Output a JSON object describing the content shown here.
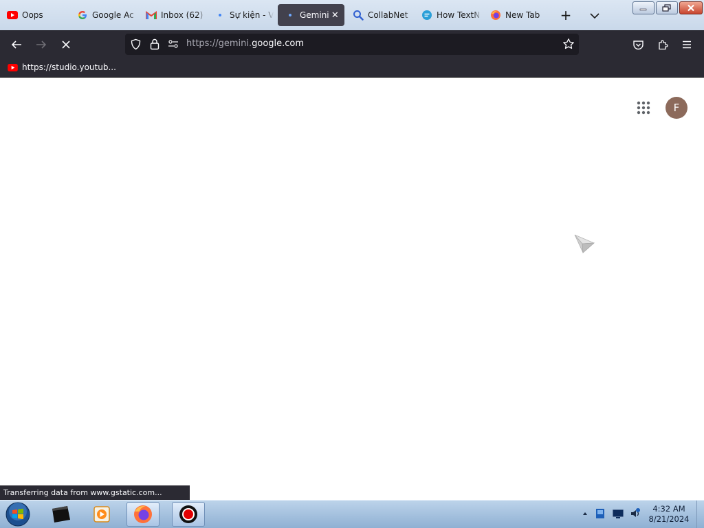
{
  "tabs": [
    {
      "title": "Oops",
      "icon": "youtube-icon"
    },
    {
      "title": "Google Ac",
      "icon": "google-icon"
    },
    {
      "title": "Inbox (62)",
      "icon": "gmail-icon"
    },
    {
      "title": "Sự kiện - V",
      "icon": "calendar-dot-icon"
    },
    {
      "title": "Gemini",
      "icon": "gemini-icon",
      "active": true,
      "close": "✕"
    },
    {
      "title": "CollabNet",
      "icon": "search-icon"
    },
    {
      "title": "How TextN",
      "icon": "chat-icon"
    },
    {
      "title": "New Tab",
      "icon": "firefox-icon"
    }
  ],
  "new_tab_label": "+",
  "nav": {
    "url_prefix": "https://gemini.",
    "url_domain": "google.com"
  },
  "bookmarks": [
    {
      "label": "https://studio.youtub...",
      "icon": "youtube-icon"
    }
  ],
  "page": {
    "avatar_letter": "F"
  },
  "status_text": "Transferring data from www.gstatic.com...",
  "taskbar": {
    "time": "4:32 AM",
    "date": "8/21/2024"
  },
  "colors": {
    "active_tab": "#42414d",
    "toolbar": "#2b2a33",
    "url_field": "#1c1b22",
    "avatar": "#8c6a5b",
    "youtube_red": "#ff0000"
  }
}
